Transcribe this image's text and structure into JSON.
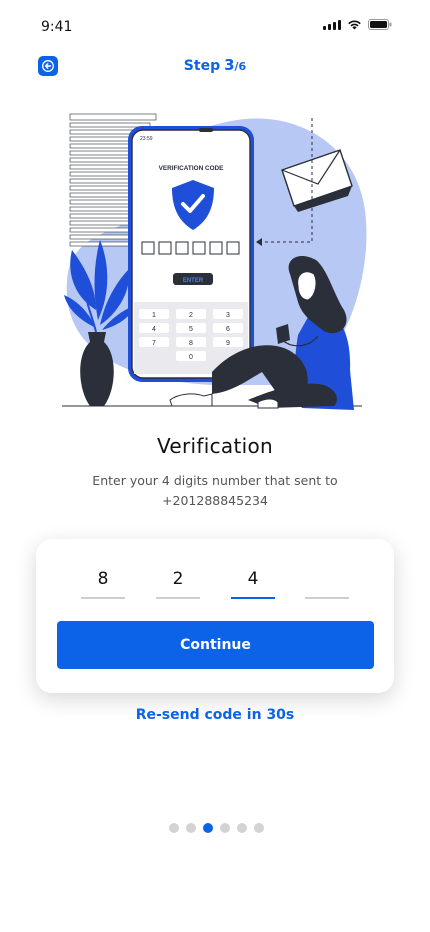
{
  "status_bar": {
    "time": "9:41"
  },
  "header": {
    "step_word": "Step",
    "step_current": "3",
    "step_total": "/6",
    "back_icon": "arrow-left-icon"
  },
  "illustration": {
    "phone_time": "23:59",
    "phone_heading": "VERIFICATION CODE",
    "phone_button": "ENTER",
    "keypad": [
      "1",
      "2",
      "3",
      "4",
      "5",
      "6",
      "7",
      "8",
      "9",
      "0"
    ]
  },
  "content": {
    "title": "Verification",
    "description_line1": "Enter your 4 digits number that sent to",
    "description_line2": "+201288845234"
  },
  "otp": {
    "digits": [
      "8",
      "2",
      "4",
      ""
    ],
    "active_index": 2
  },
  "actions": {
    "continue_label": "Continue",
    "resend_label": "Re-send code in 30s"
  },
  "pagination": {
    "total": 6,
    "active": 3
  },
  "colors": {
    "accent": "#0d63e8",
    "illustration_blue": "#1f4fd8",
    "illustration_light_blue": "#b8c8f5",
    "dark": "#2b2f3a",
    "inactive_dot": "#d3d3d3"
  }
}
